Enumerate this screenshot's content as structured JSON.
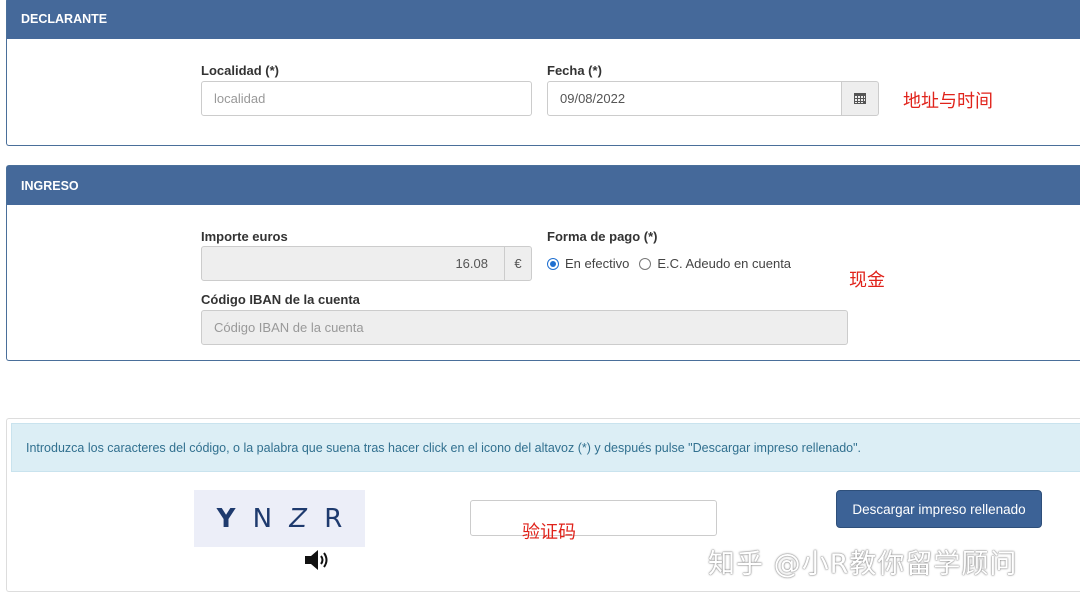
{
  "declarante": {
    "header": "DECLARANTE",
    "localidad_label": "Localidad (*)",
    "localidad_placeholder": "localidad",
    "fecha_label": "Fecha (*)",
    "fecha_value": "09/08/2022",
    "annotation": "地址与时间"
  },
  "ingreso": {
    "header": "INGRESO",
    "importe_label": "Importe euros",
    "importe_value": "16.08",
    "currency_symbol": "€",
    "forma_pago_label": "Forma de pago (*)",
    "payment_options": [
      {
        "label": "En efectivo",
        "checked": true
      },
      {
        "label": "E.C. Adeudo en cuenta",
        "checked": false
      }
    ],
    "iban_label": "Código IBAN de la cuenta",
    "iban_placeholder": "Código IBAN de la cuenta",
    "annotation": "现金"
  },
  "captcha": {
    "instructions": "Introduzca los caracteres del código, o la palabra que suena tras hacer click en el icono del altavoz (*) y después pulse \"Descargar impreso rellenado\".",
    "chars": [
      "Y",
      "N",
      "Z",
      "R"
    ],
    "input_annotation": "验证码",
    "download_button": "Descargar impreso rellenado",
    "speaker_icon": "speaker-icon"
  },
  "watermark": "知乎 @小R教你留学顾问",
  "colors": {
    "header_bg": "#45699a",
    "button_bg": "#3c6296",
    "annotation": "#e0231b",
    "info_bg": "#dceef5"
  }
}
